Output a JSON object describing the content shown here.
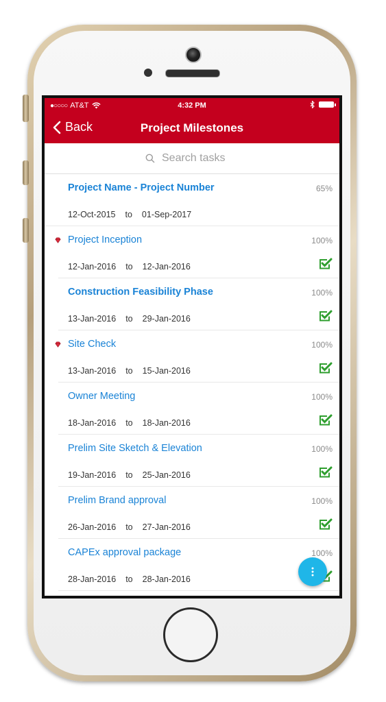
{
  "status_bar": {
    "carrier": "AT&T",
    "time": "4:32 PM"
  },
  "nav": {
    "back_label": "Back",
    "title": "Project Milestones"
  },
  "search": {
    "placeholder": "Search tasks"
  },
  "tasks": [
    {
      "name": "Project Name - Project Number",
      "percent": "65%",
      "start": "12-Oct-2015",
      "to": "to",
      "end": "01-Sep-2017",
      "bold": true,
      "milestone": false,
      "complete": false
    },
    {
      "name": "Project Inception",
      "percent": "100%",
      "start": "12-Jan-2016",
      "to": "to",
      "end": "12-Jan-2016",
      "bold": false,
      "milestone": true,
      "complete": true
    },
    {
      "name": "Construction Feasibility Phase",
      "percent": "100%",
      "start": "13-Jan-2016",
      "to": "to",
      "end": "29-Jan-2016",
      "bold": true,
      "milestone": false,
      "complete": true
    },
    {
      "name": "Site Check",
      "percent": "100%",
      "start": "13-Jan-2016",
      "to": "to",
      "end": "15-Jan-2016",
      "bold": false,
      "milestone": true,
      "complete": true
    },
    {
      "name": "Owner Meeting",
      "percent": "100%",
      "start": "18-Jan-2016",
      "to": "to",
      "end": "18-Jan-2016",
      "bold": false,
      "milestone": false,
      "complete": true
    },
    {
      "name": "Prelim Site Sketch & Elevation",
      "percent": "100%",
      "start": "19-Jan-2016",
      "to": "to",
      "end": "25-Jan-2016",
      "bold": false,
      "milestone": false,
      "complete": true
    },
    {
      "name": "Prelim Brand approval",
      "percent": "100%",
      "start": "26-Jan-2016",
      "to": "to",
      "end": "27-Jan-2016",
      "bold": false,
      "milestone": false,
      "complete": true
    },
    {
      "name": "CAPEx approval package",
      "percent": "100%",
      "start": "28-Jan-2016",
      "to": "to",
      "end": "28-Jan-2016",
      "bold": false,
      "milestone": false,
      "complete": true
    }
  ],
  "fab_icon": "more-vertical-icon",
  "colors": {
    "accent": "#c4001e",
    "link": "#1a83d6",
    "check": "#2e9e2e",
    "fab": "#1fb6e8"
  }
}
